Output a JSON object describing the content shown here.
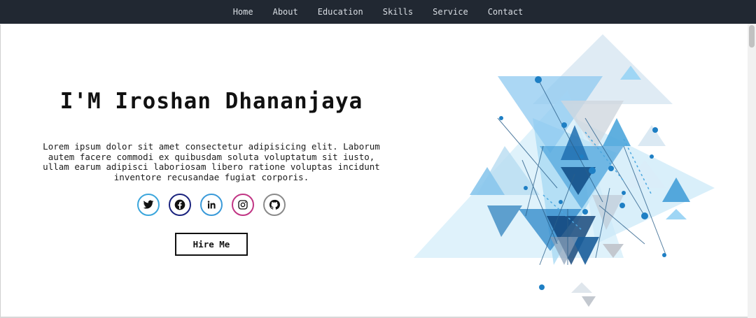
{
  "nav": {
    "items": [
      {
        "label": "Home"
      },
      {
        "label": "About"
      },
      {
        "label": "Education"
      },
      {
        "label": "Skills"
      },
      {
        "label": "Service"
      },
      {
        "label": "Contact"
      }
    ]
  },
  "hero": {
    "title": "I'M Iroshan Dhananjaya",
    "description": "Lorem ipsum dolor sit amet consectetur adipisicing elit. Laborum autem facere commodi ex quibusdam soluta voluptatum sit iusto, ullam earum adipisci laboriosam libero ratione voluptas incidunt inventore recusandae fugiat corporis.",
    "hire_label": "Hire Me"
  },
  "socials": [
    {
      "name": "twitter",
      "icon": "twitter-icon",
      "color": "#1da1f2"
    },
    {
      "name": "facebook",
      "icon": "facebook-icon",
      "color": "#1a237e"
    },
    {
      "name": "linkedin",
      "icon": "linkedin-icon",
      "color": "#0a66c2"
    },
    {
      "name": "instagram",
      "icon": "instagram-icon",
      "color": "#c13584"
    },
    {
      "name": "github",
      "icon": "github-icon",
      "color": "#777777"
    }
  ],
  "colors": {
    "nav_bg": "#212832",
    "accent_blue": "#1e88c8",
    "light_blue": "#9fd6f5"
  }
}
